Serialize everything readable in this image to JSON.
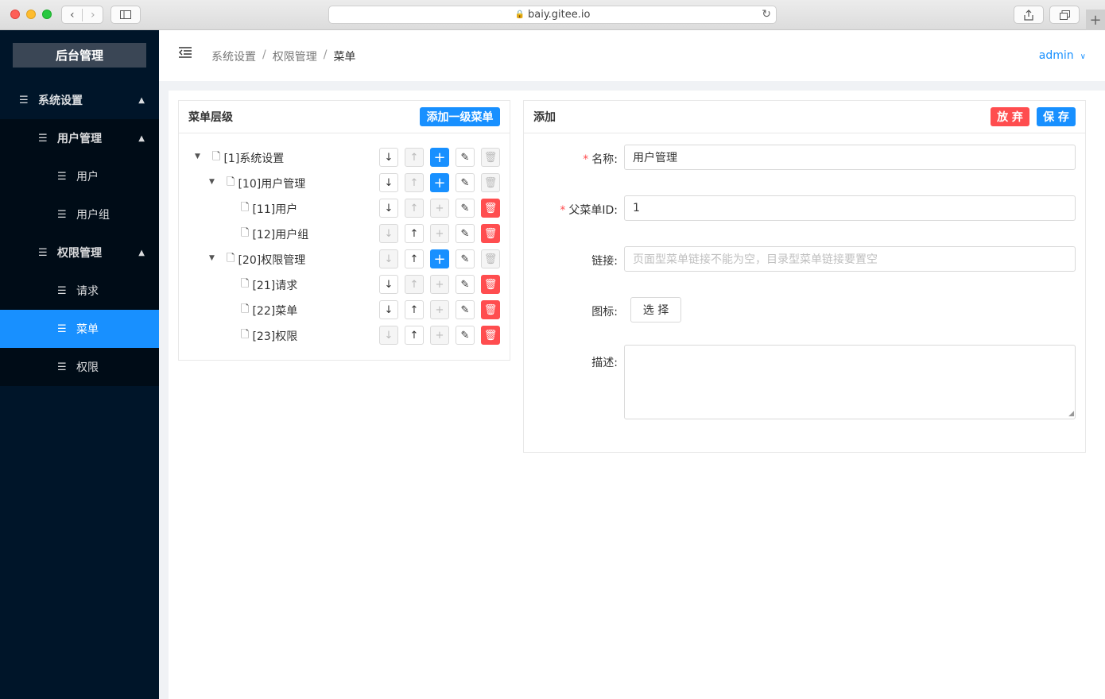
{
  "browser": {
    "url": "baiy.gitee.io",
    "back_icon": "chevron-left",
    "forward_icon": "chevron-right",
    "plus_label": "+"
  },
  "sidebar": {
    "logo": "后台管理",
    "items": [
      {
        "label": "系统设置"
      },
      {
        "label": "用户管理"
      },
      {
        "label": "用户"
      },
      {
        "label": "用户组"
      },
      {
        "label": "权限管理"
      },
      {
        "label": "请求"
      },
      {
        "label": "菜单"
      },
      {
        "label": "权限"
      }
    ],
    "active_color": "#1890ff"
  },
  "header": {
    "breadcrumb": [
      "系统设置",
      "权限管理",
      "菜单"
    ],
    "user": "admin"
  },
  "tree_card": {
    "title": "菜单层级",
    "add_top_label": "添加一级菜单",
    "nodes": [
      {
        "label": "[1]系统设置"
      },
      {
        "label": "[10]用户管理"
      },
      {
        "label": "[11]用户"
      },
      {
        "label": "[12]用户组"
      },
      {
        "label": "[20]权限管理"
      },
      {
        "label": "[21]请求"
      },
      {
        "label": "[22]菜单"
      },
      {
        "label": "[23]权限"
      }
    ]
  },
  "form_card": {
    "title": "添加",
    "discard_label": "放 弃",
    "save_label": "保 存",
    "name_label": "名称:",
    "name_value": "用户管理",
    "parent_label": "父菜单ID:",
    "parent_value": "1",
    "link_label": "链接:",
    "link_placeholder": "页面型菜单链接不能为空，目录型菜单链接要置空",
    "icon_label": "图标:",
    "icon_select_label": "选 择",
    "desc_label": "描述:",
    "required_mark": "*"
  },
  "colors": {
    "primary": "#1890ff",
    "danger": "#ff4d4f",
    "sidebar_bg": "#001529"
  }
}
